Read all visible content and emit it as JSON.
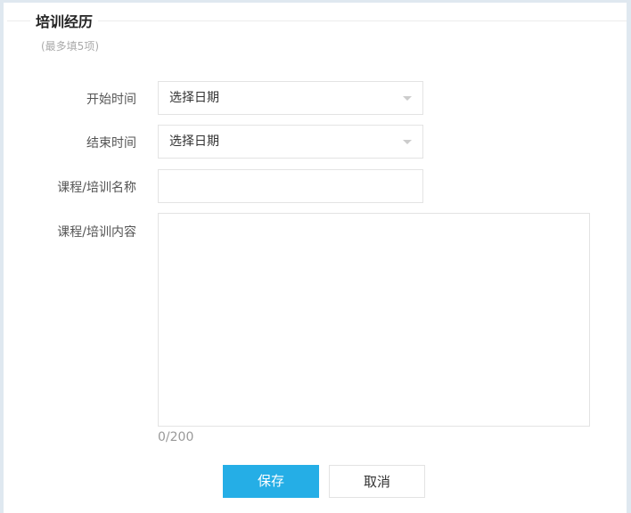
{
  "section": {
    "title": "培训经历",
    "hint": "(最多填5项)"
  },
  "form": {
    "start": {
      "label": "开始时间",
      "placeholder": "选择日期"
    },
    "end": {
      "label": "结束时间",
      "placeholder": "选择日期"
    },
    "name": {
      "label": "课程/培训名称",
      "value": ""
    },
    "content": {
      "label": "课程/培训内容",
      "value": "",
      "counter": "0/200"
    }
  },
  "buttons": {
    "save": "保存",
    "cancel": "取消"
  }
}
